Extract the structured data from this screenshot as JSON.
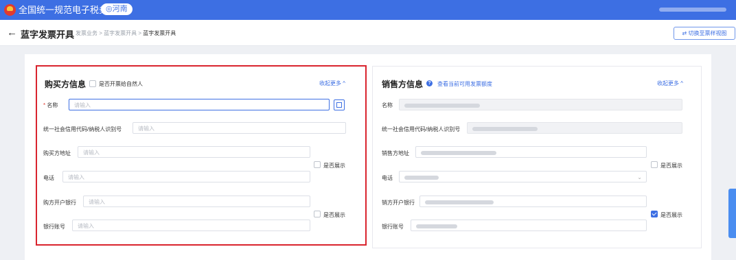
{
  "header": {
    "site_name": "全国统一规范电子税务局",
    "region": "◎河南",
    "user_icon": "user-icon"
  },
  "page": {
    "back_icon": "back-arrow-icon",
    "title": "蓝字发票开具",
    "breadcrumb": [
      "发票业务",
      "蓝字发票开具",
      "蓝字发票开具"
    ],
    "switch_button": "⇄ 切换至票样视图"
  },
  "buyer": {
    "title": "购买方信息",
    "natural_person_label": "是否开票给自然人",
    "collapse_link": "收起更多 ^",
    "name_label": "名称",
    "name_required": "*",
    "name_placeholder": "请输入",
    "tax_id_label": "统一社会信用代码/纳税人识别号",
    "tax_id_placeholder": "请输入",
    "address_label": "购买方地址",
    "address_placeholder": "请输入",
    "show_label_1": "是否展示",
    "phone_label": "电话",
    "phone_placeholder": "请输入",
    "bank_label": "购方开户银行",
    "bank_placeholder": "请输入",
    "show_label_2": "是否展示",
    "account_label": "银行账号",
    "account_placeholder": "请输入"
  },
  "seller": {
    "title": "销售方信息",
    "quota_link": "查看当前可用发票额度",
    "collapse_link": "收起更多 ^",
    "name_label": "名称",
    "tax_id_label": "统一社会信用代码/纳税人识别号",
    "address_label": "销售方地址",
    "show_label_1": "是否展示",
    "phone_label": "电话",
    "bank_label": "销方开户银行",
    "show_label_2": "是否展示",
    "show_2_checked": true,
    "account_label": "银行账号"
  },
  "colors": {
    "primary": "#3d6fe3",
    "highlight_border": "#d9232d"
  }
}
